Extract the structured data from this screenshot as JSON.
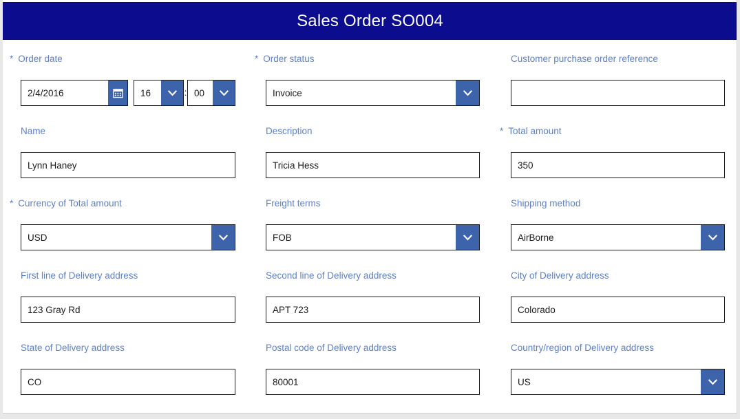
{
  "header": {
    "title": "Sales Order SO004",
    "background_color": "#0c0c8e",
    "text_color": "#ffffff"
  },
  "theme": {
    "label_color": "#5d81c9",
    "accent_button_color": "#3d63ab",
    "field_border_color": "#1a1a1a",
    "page_background": "#e8e8e8",
    "card_background": "#ffffff"
  },
  "form": {
    "order_date": {
      "label": "Order date",
      "required_marker": "*",
      "required": true,
      "value": "2/4/2016",
      "placeholder": "",
      "calendar_icon": "calendar-icon",
      "hour": "16",
      "minute": "00",
      "time_separator": ":",
      "hour_chevron_icon": "chevron-down-icon",
      "minute_chevron_icon": "chevron-down-icon"
    },
    "order_status": {
      "label": "Order status",
      "required_marker": "*",
      "required": true,
      "value": "Invoice",
      "chevron_icon": "chevron-down-icon"
    },
    "customer_po_reference": {
      "label": "Customer purchase order reference",
      "required": false,
      "value": "",
      "placeholder": ""
    },
    "name": {
      "label": "Name",
      "required": false,
      "value": "Lynn Haney",
      "placeholder": ""
    },
    "description": {
      "label": "Description",
      "required": false,
      "value": "Tricia Hess",
      "placeholder": ""
    },
    "total_amount": {
      "label": "Total amount",
      "required_marker": "*",
      "required": true,
      "value": "350",
      "placeholder": ""
    },
    "currency_of_total_amount": {
      "label": "Currency of Total amount",
      "required_marker": "*",
      "required": true,
      "value": "USD",
      "chevron_icon": "chevron-down-icon"
    },
    "freight_terms": {
      "label": "Freight terms",
      "required": false,
      "value": "FOB",
      "chevron_icon": "chevron-down-icon"
    },
    "shipping_method": {
      "label": "Shipping method",
      "required": false,
      "value": "AirBorne",
      "chevron_icon": "chevron-down-icon"
    },
    "delivery_address_line1": {
      "label": "First line of Delivery address",
      "required": false,
      "value": "123 Gray Rd",
      "placeholder": ""
    },
    "delivery_address_line2": {
      "label": "Second line of Delivery address",
      "required": false,
      "value": "APT 723",
      "placeholder": ""
    },
    "delivery_address_city": {
      "label": "City of Delivery address",
      "required": false,
      "value": "Colorado",
      "placeholder": ""
    },
    "delivery_address_state": {
      "label": "State of Delivery address",
      "required": false,
      "value": "CO",
      "placeholder": ""
    },
    "delivery_address_postal_code": {
      "label": "Postal code of Delivery address",
      "required": false,
      "value": "80001",
      "placeholder": ""
    },
    "delivery_address_country": {
      "label": "Country/region of Delivery address",
      "required": false,
      "value": "US",
      "chevron_icon": "chevron-down-icon"
    }
  }
}
